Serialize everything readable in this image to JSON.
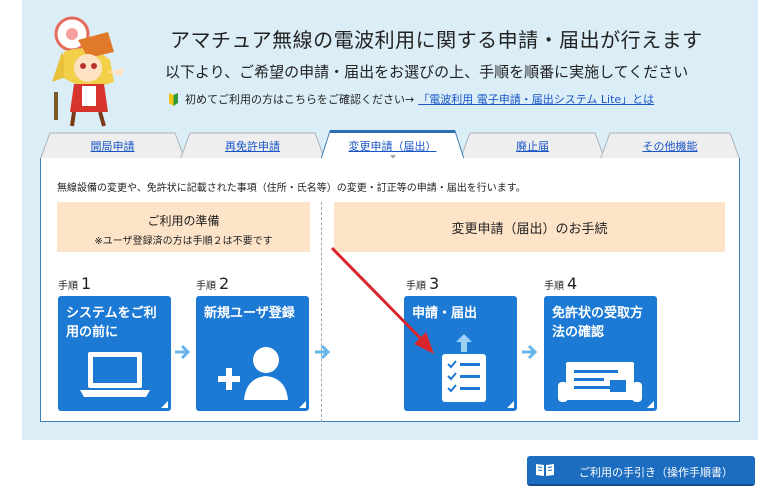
{
  "header": {
    "title": "アマチュア無線の電波利用に関する申請・届出が行えます",
    "subtitle": "以下より、ご希望の申請・届出をお選びの上、手順を順番に実施してください",
    "first_time_text": "初めてご利用の方はこちらをご確認ください→",
    "first_time_link": "「電波利用 電子申請・届出システム Lite」とは"
  },
  "tabs": [
    {
      "label": "開局申請",
      "active": false
    },
    {
      "label": "再免許申請",
      "active": false
    },
    {
      "label": "変更申請（届出）",
      "active": true
    },
    {
      "label": "廃止届",
      "active": false
    },
    {
      "label": "その他機能",
      "active": false
    }
  ],
  "content": {
    "description": "無線設備の変更や、免許状に記載された事項（住所・氏名等）の変更・訂正等の申請・届出を行います。",
    "preparation": {
      "title": "ご利用の準備",
      "note": "※ユーザ登録済の方は手順２は不要です"
    },
    "procedure_title": "変更申請（届出）のお手続",
    "steps": [
      {
        "prefix": "手順",
        "number": "1",
        "title": "システムをご利用の前に",
        "icon": "laptop-icon"
      },
      {
        "prefix": "手順",
        "number": "2",
        "title": "新規ユーザ登録",
        "icon": "add-user-icon"
      },
      {
        "prefix": "手順",
        "number": "3",
        "title": "申請・届出",
        "icon": "checklist-upload-icon"
      },
      {
        "prefix": "手順",
        "number": "4",
        "title": "免許状の受取方法の確認",
        "icon": "license-document-icon"
      }
    ]
  },
  "guide_button": {
    "label": "ご利用の手引き（操作手順書）",
    "icon": "book-icon"
  },
  "colors": {
    "panel_bg": "#dbeef8",
    "card_blue": "#1c7ad4",
    "header_orange": "#fde3c8",
    "link_blue": "#1a56c8",
    "arrow_red": "#d9262b"
  }
}
